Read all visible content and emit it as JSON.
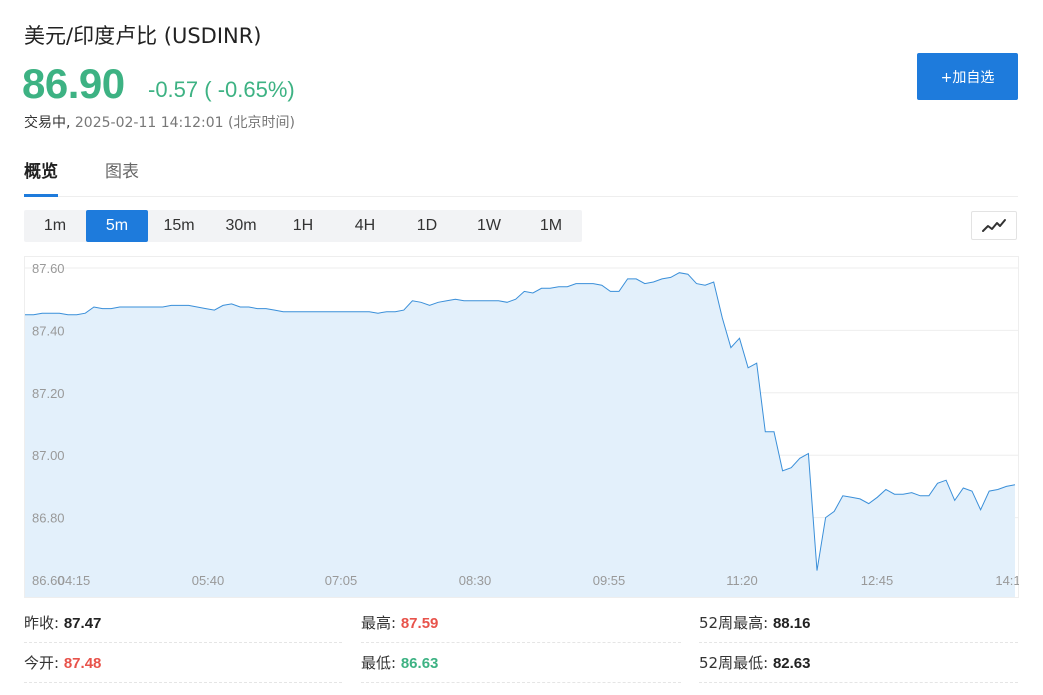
{
  "header": {
    "title": "美元/印度卢比  (USDINR)",
    "price": "86.90",
    "change": "-0.57 ( -0.65%)",
    "status_state": "交易中,",
    "status_time": " 2025-02-11 14:12:01  (北京时间)",
    "add_button": "+加自选"
  },
  "tabs": [
    "概览",
    "图表"
  ],
  "periods": [
    "1m",
    "5m",
    "15m",
    "30m",
    "1H",
    "4H",
    "1D",
    "1W",
    "1M"
  ],
  "active_period": "5m",
  "chart_type_icon": "line-chart-icon",
  "colors": {
    "up": "#e8534b",
    "down": "#3db283",
    "accent": "#1e7bdc",
    "line": "#3a8fd9",
    "area": "#e3f0fb"
  },
  "stats": {
    "prev_close_label": "昨收:",
    "prev_close_value": "87.47",
    "open_label": "今开:",
    "open_value": "87.48",
    "high_label": "最高:",
    "high_value": "87.59",
    "low_label": "最低:",
    "low_value": "86.63",
    "wk52_high_label": "52周最高:",
    "wk52_high_value": "88.16",
    "wk52_low_label": "52周最低:",
    "wk52_low_value": "82.63"
  },
  "chart_data": {
    "type": "area",
    "ylim": [
      86.6,
      87.6
    ],
    "yticks": [
      "87.60",
      "87.40",
      "87.20",
      "87.00",
      "86.80",
      "86.60"
    ],
    "xticks": [
      "04:15",
      "05:40",
      "07:05",
      "08:30",
      "09:55",
      "11:20",
      "12:45",
      "14:1"
    ],
    "x_start": "04:15",
    "x_step_minutes": 5,
    "values": [
      87.45,
      87.45,
      87.455,
      87.455,
      87.455,
      87.45,
      87.45,
      87.455,
      87.475,
      87.47,
      87.47,
      87.475,
      87.475,
      87.475,
      87.475,
      87.475,
      87.475,
      87.48,
      87.48,
      87.48,
      87.475,
      87.47,
      87.465,
      87.48,
      87.485,
      87.475,
      87.475,
      87.47,
      87.47,
      87.465,
      87.46,
      87.46,
      87.46,
      87.46,
      87.46,
      87.46,
      87.46,
      87.46,
      87.46,
      87.46,
      87.46,
      87.455,
      87.46,
      87.46,
      87.465,
      87.495,
      87.49,
      87.48,
      87.49,
      87.495,
      87.5,
      87.495,
      87.495,
      87.495,
      87.495,
      87.495,
      87.49,
      87.5,
      87.525,
      87.52,
      87.535,
      87.535,
      87.54,
      87.54,
      87.55,
      87.55,
      87.55,
      87.545,
      87.525,
      87.525,
      87.565,
      87.565,
      87.55,
      87.555,
      87.565,
      87.57,
      87.585,
      87.58,
      87.55,
      87.545,
      87.555,
      87.44,
      87.345,
      87.375,
      87.28,
      87.295,
      87.075,
      87.075,
      86.95,
      86.96,
      86.99,
      87.005,
      86.63,
      86.8,
      86.82,
      86.87,
      86.865,
      86.86,
      86.845,
      86.865,
      86.89,
      86.875,
      86.875,
      86.88,
      86.87,
      86.87,
      86.91,
      86.92,
      86.855,
      86.895,
      86.885,
      86.825,
      86.885,
      86.89,
      86.9,
      86.905
    ]
  }
}
